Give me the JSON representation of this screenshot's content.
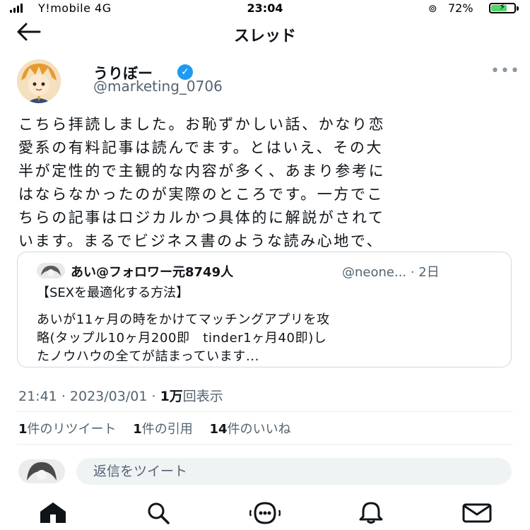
{
  "status_bar": {
    "carrier": "Y!mobile  4G",
    "time": "23:04",
    "battery": "72%",
    "battery_level": 0.72
  },
  "header": {
    "title": "スレッド"
  },
  "tweet": {
    "author_name": "うりぼー",
    "handle": "@marketing_0706",
    "text": "こちら拝読しました。お恥ずかしい話、かなり恋\n愛系の有料記事は読んでます。とはいえ、その大\n半が定性的で主観的な内容が多く、あまり参考に\nはならなかったのが実際のところです。一方でこ\nちらの記事はロジカルかつ具体的に解説がされて\nいます。まるでビジネス書のような読み心地で、",
    "time": "21:41",
    "date": "2023/03/01",
    "views_count": "1万",
    "views_label": "回表示"
  },
  "quote": {
    "name": "あい@フォロワー元8749人",
    "handle_date": "@neone... · 2日",
    "title": "【SEXを最適化する方法】",
    "body": "あいが11ヶ月の時をかけてマッチングアプリを攻\n略(タップル10ヶ月200即　tinder1ヶ月40即)し\nたノウハウの全てが詰まっています..."
  },
  "stats": {
    "retweets_count": "1",
    "retweets_label": "件のリツイート",
    "quotes_count": "1",
    "quotes_label": "件の引用",
    "likes_count": "14",
    "likes_label": "件のいいね"
  },
  "reply": {
    "placeholder": "返信をツイート"
  },
  "colors": {
    "accent": "#1d9bf0",
    "text": "#0f1419",
    "secondary": "#536471",
    "divider": "#e7ebee"
  },
  "nav": {
    "icons": [
      "home-icon",
      "search-icon",
      "spaces-icon",
      "notifications-icon",
      "messages-icon"
    ]
  }
}
